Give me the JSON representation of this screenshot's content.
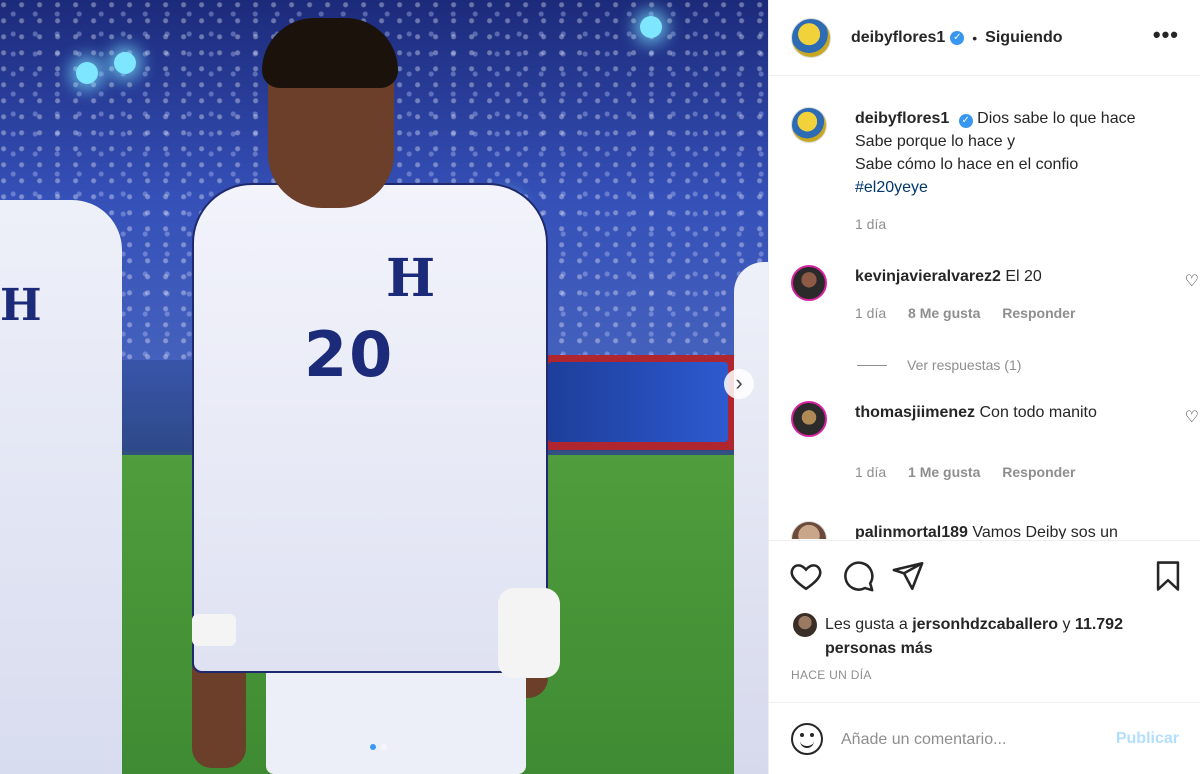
{
  "post": {
    "author": "deibyflores1",
    "follow_status": "Siguiendo",
    "more_label": "•••",
    "separator": "•",
    "verified_mark": "✓",
    "carousel_next": "›"
  },
  "caption": {
    "username": "deibyflores1",
    "line1": "Dios sabe lo que hace",
    "line2": "Sabe porque lo hace y",
    "line3": "Sabe cómo lo hace en el confio",
    "hashtag": "#el20yeye",
    "time": "1 día"
  },
  "comments": [
    {
      "username": "kevinjavieralvarez2",
      "text": "El 20",
      "time": "1 día",
      "likes": "8 Me gusta",
      "reply": "Responder"
    },
    {
      "username": "thomasjiimenez",
      "text": "Con todo manito",
      "time": "1 día",
      "likes": "1 Me gusta",
      "reply": "Responder"
    },
    {
      "username": "palinmortal189",
      "text": "Vamos Deiby sos un"
    }
  ],
  "view_replies": "Ver respuestas (1)",
  "likes": {
    "prefix": "Les gusta a",
    "user": "jersonhdzcaballero",
    "connector": "y",
    "count": "11.792 personas más"
  },
  "posted_ago": "HACE UN DÍA",
  "comment_box": {
    "placeholder": "Añade un comentario...",
    "publish_label": "Publicar"
  },
  "photo": {
    "jersey_letter": "H",
    "jersey_number": "20"
  },
  "icons": [
    "heart-icon",
    "comment-icon",
    "share-icon",
    "bookmark-icon",
    "emoji-icon",
    "more-icon",
    "verified-icon"
  ],
  "colors": {
    "link": "#00376b",
    "verified": "#3897f0",
    "muted": "#8e8e8e",
    "publish_disabled": "#b2dffc"
  }
}
